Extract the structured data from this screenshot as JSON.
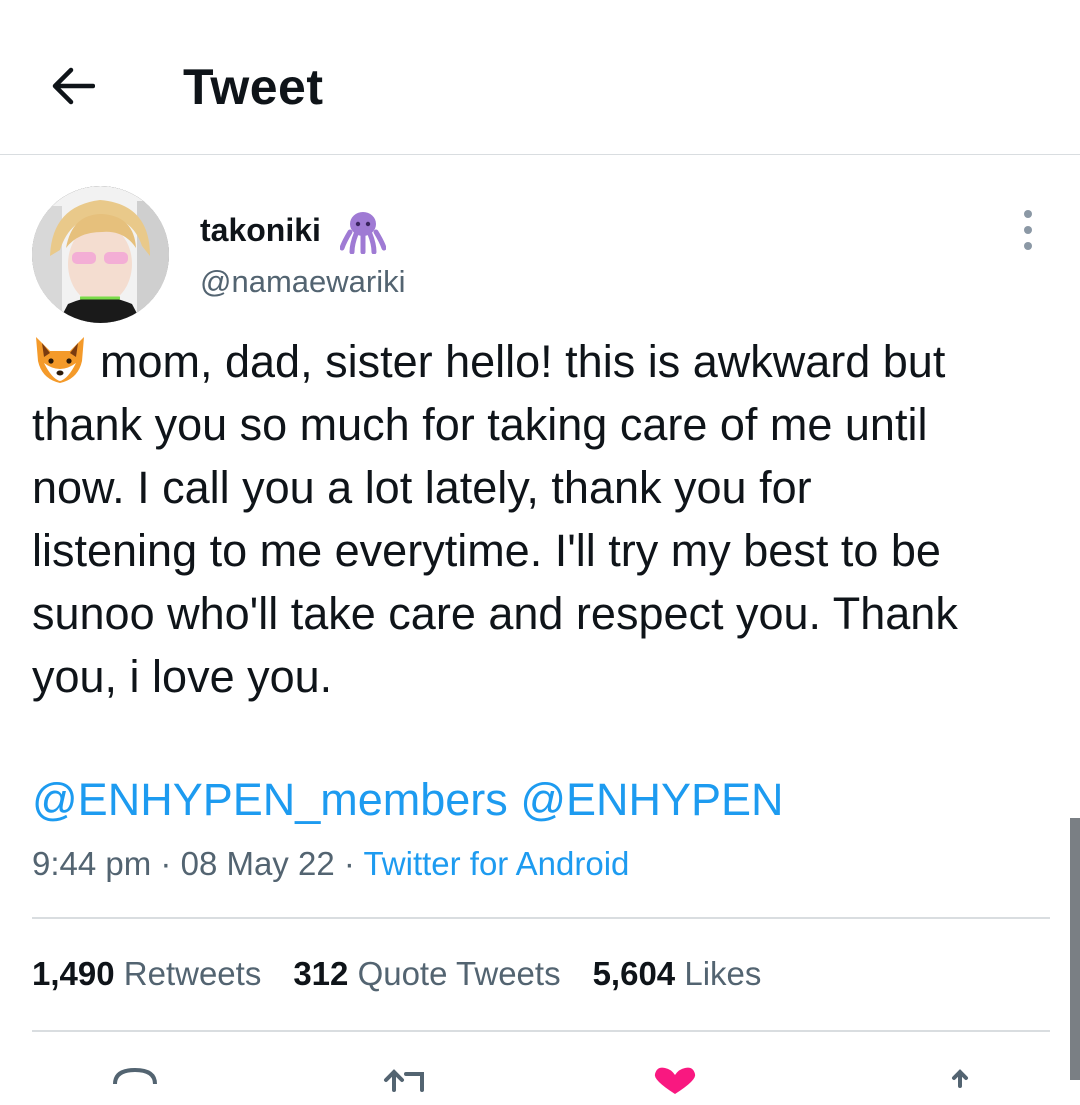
{
  "header": {
    "title": "Tweet",
    "back_icon": "arrow-left-icon"
  },
  "author": {
    "display_name": "takoniki",
    "name_emoji": "octopus-icon",
    "handle": "@namaewariki",
    "avatar": "avatar"
  },
  "tweet": {
    "leading_emoji": "fox-icon",
    "text": "mom, dad, sister hello! this is awkward but\nthank you so much for taking care of me until\nnow. I call you a lot lately, thank you for\nlistening to me everytime. I'll try my best to be\nsunoo who'll take care and respect you. Thank\nyou, i love you.",
    "mentions": [
      "@ENHYPEN_members",
      "@ENHYPEN"
    ],
    "time": "9:44 pm",
    "separator": "·",
    "date": "08 May 22",
    "source": "Twitter for Android"
  },
  "stats": {
    "retweets_count": "1,490",
    "retweets_label": "Retweets",
    "quotes_count": "312",
    "quotes_label": "Quote Tweets",
    "likes_count": "5,604",
    "likes_label": "Likes"
  },
  "colors": {
    "link": "#1d9bf0",
    "secondary_text": "#536471",
    "like_active": "#f91880"
  }
}
